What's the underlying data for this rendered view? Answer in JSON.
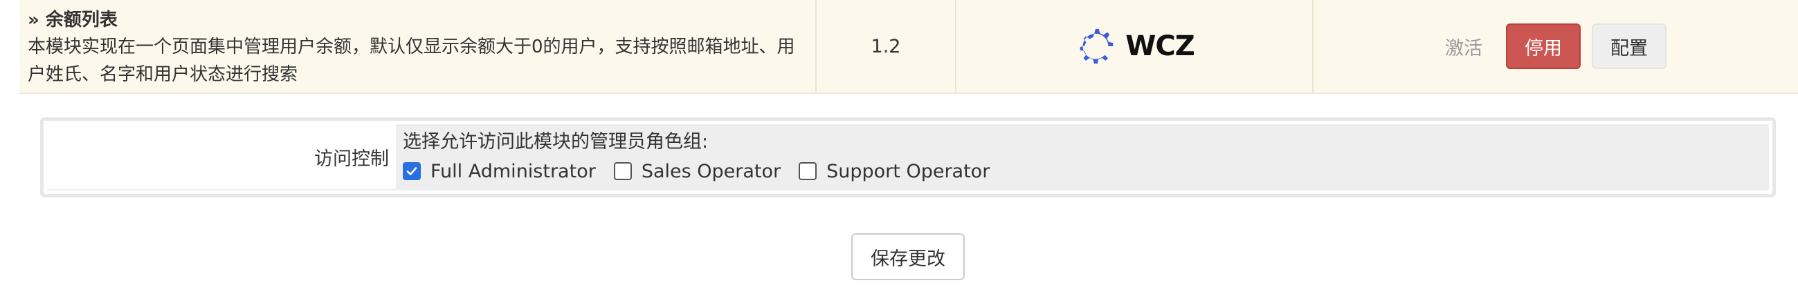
{
  "module": {
    "title": "» 余额列表",
    "description": "本模块实现在一个页面集中管理用户余额，默认仅显示余额大于0的用户，支持按照邮箱地址、用户姓氏、名字和用户状态进行搜索",
    "version": "1.2",
    "vendor_logo_text": "WCZ",
    "vendor_logo_color": "#3b5bdb",
    "enable_label": "激活",
    "disable_label": "停用",
    "configure_label": "配置",
    "row_background": "#fcf8ec",
    "disable_button_color": "#cc5652"
  },
  "access_control": {
    "label": "访问控制",
    "prompt": "选择允许访问此模块的管理员角色组:",
    "roles": [
      {
        "label": "Full Administrator",
        "checked": true
      },
      {
        "label": "Sales Operator",
        "checked": false
      },
      {
        "label": "Support Operator",
        "checked": false
      }
    ],
    "checkbox_accent": "#2a6fe0"
  },
  "save_label": "保存更改",
  "icons": {
    "logo": "gear-logo-icon",
    "check": "checkmark-icon"
  }
}
